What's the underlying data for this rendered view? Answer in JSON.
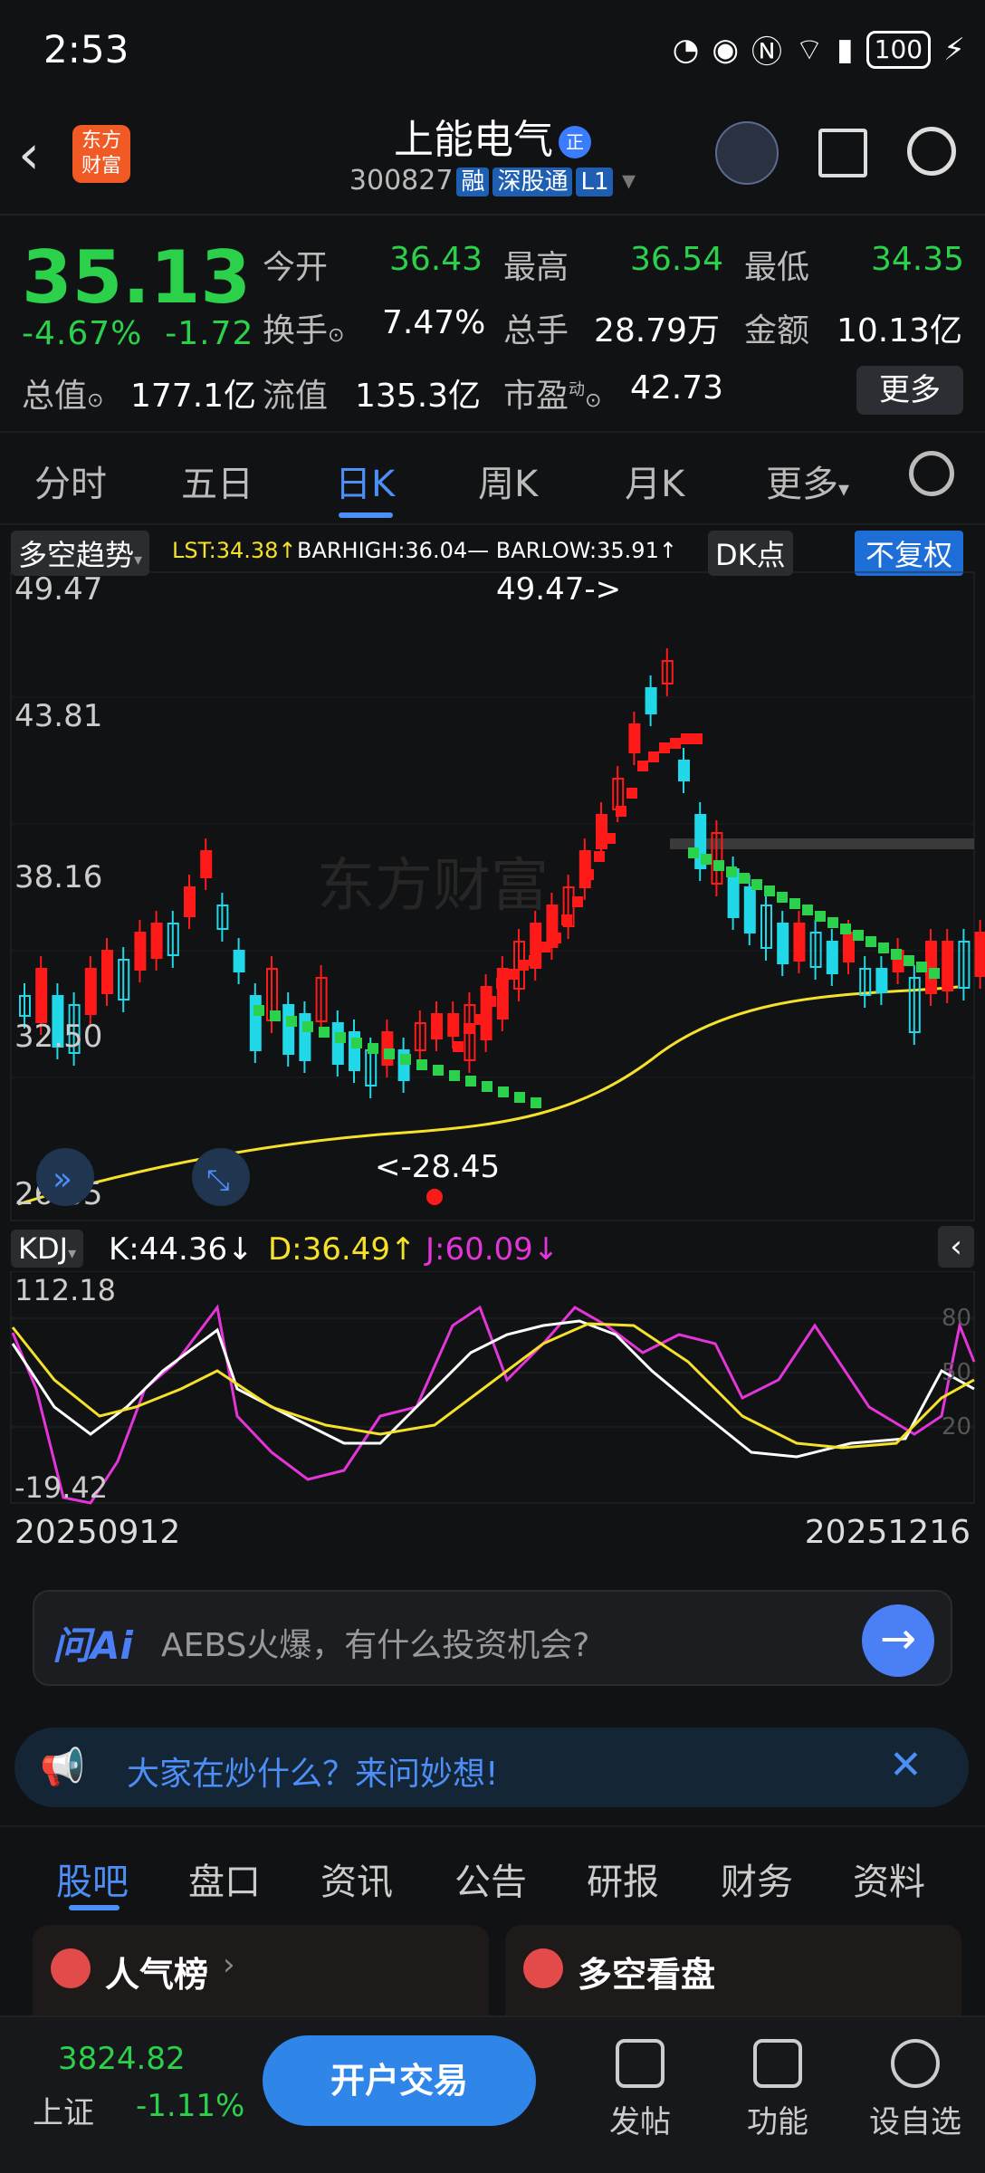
{
  "status": {
    "time": "2:53",
    "battery": "100"
  },
  "header": {
    "logo_text": "东方财富",
    "name": "上能电气",
    "badge": "正",
    "code": "300827",
    "tags": [
      "融",
      "深股通",
      "L1"
    ]
  },
  "quote": {
    "price": "35.13",
    "change_pct": "-4.67%",
    "change": "-1.72",
    "fields": [
      {
        "label": "今开",
        "value": "36.43",
        "green": true
      },
      {
        "label": "最高",
        "value": "36.54",
        "green": true
      },
      {
        "label": "最低",
        "value": "34.35",
        "green": true
      },
      {
        "label": "换手",
        "value": "7.47%",
        "green": false
      },
      {
        "label": "总手",
        "value": "28.79万",
        "green": false
      },
      {
        "label": "金额",
        "value": "10.13亿",
        "green": false
      },
      {
        "label": "总值",
        "value": "177.1亿",
        "green": false
      },
      {
        "label": "流值",
        "value": "135.3亿",
        "green": false
      },
      {
        "label": "市盈",
        "value": "42.73",
        "green": false,
        "sup": "动"
      }
    ],
    "more": "更多"
  },
  "tabs": [
    "分时",
    "五日",
    "日K",
    "周K",
    "月K",
    "更多"
  ],
  "indicator": {
    "name": "多空趋势",
    "lst": "LST:34.38↑",
    "bar": "BARHIGH:36.04— BARLOW:35.91↑",
    "dk": "DK点",
    "fq": "不复权",
    "watermark": "东方财富"
  },
  "chart": {
    "y_labels": [
      "49.47",
      "43.81",
      "38.16",
      "32.50",
      "26.85"
    ],
    "high_note": "49.47->",
    "low_note": "<-28.45"
  },
  "kdj": {
    "name": "KDJ",
    "k": "K:44.36↓",
    "d": "D:36.49↑",
    "j": "J:60.09↓",
    "y_top": "112.18",
    "y_bottom": "-19.42",
    "levels": [
      "80",
      "50",
      "20"
    ]
  },
  "dates": {
    "start": "20250912",
    "end": "20251216"
  },
  "ai": {
    "logo": "问Ai",
    "placeholder": "AEBS火爆，有什么投资机会?",
    "send": "→"
  },
  "banner": {
    "text": "大家在炒什么？来问妙想!"
  },
  "bottom_tabs": [
    "股吧",
    "盘口",
    "资讯",
    "公告",
    "研报",
    "财务",
    "资料"
  ],
  "cards": [
    {
      "title": "人气榜"
    },
    {
      "title": "多空看盘"
    }
  ],
  "footer": {
    "index_value": "3824.82",
    "index_name": "上证",
    "index_change": "-1.11%",
    "open": "开户交易",
    "items": [
      "发帖",
      "功能",
      "设自选"
    ]
  },
  "colors": {
    "up": "#ff1a1a",
    "down": "#20d8e8",
    "accent": "#4d8ff8",
    "green": "#2bd14a"
  }
}
